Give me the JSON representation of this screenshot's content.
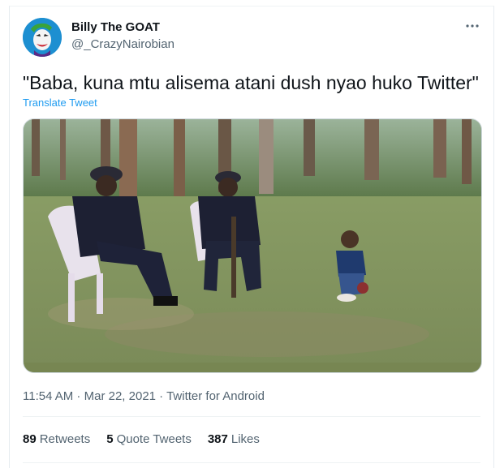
{
  "author": {
    "name": "Billy The GOAT",
    "handle": "@_CrazyNairobian"
  },
  "tweet": {
    "text": "\"Baba, kuna mtu alisema atani dush nyao huko Twitter\"",
    "translate_label": "Translate Tweet"
  },
  "meta": {
    "time": "11:54 AM",
    "separator1": " · ",
    "date": "Mar 22, 2021",
    "separator2": " · ",
    "source": "Twitter for Android"
  },
  "stats": {
    "retweets_count": "89",
    "retweets_label": "Retweets",
    "quotes_count": "5",
    "quotes_label": "Quote Tweets",
    "likes_count": "387",
    "likes_label": "Likes"
  },
  "icons": {
    "more": "more-options-icon",
    "avatar": "joker-avatar"
  },
  "colors": {
    "link": "#1d9bf0",
    "secondary": "#536471",
    "avatar_bg": "#1d8fd1"
  }
}
